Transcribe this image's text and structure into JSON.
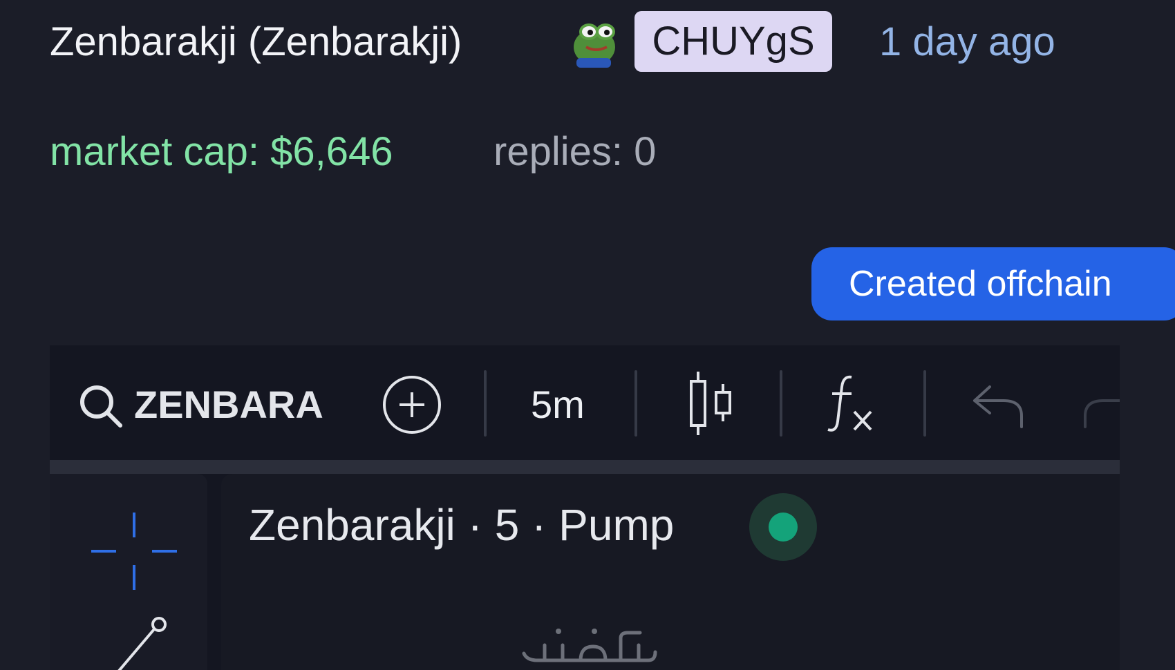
{
  "header": {
    "token_title": "Zenbarakji (Zenbarakji)",
    "ticker": "CHUYgS",
    "time_ago": "1 day ago",
    "avatar_icon": "frog-avatar-icon"
  },
  "stats": {
    "market_cap": "market cap: $6,646",
    "replies": "replies: 0"
  },
  "created_button": {
    "label": "Created offchain"
  },
  "chart_widget": {
    "toolbar": {
      "symbol": "ZENBARA",
      "interval": "5m",
      "icons": [
        "search-icon",
        "add-icon",
        "candlestick-icon",
        "fx-icon",
        "undo-icon",
        "redo-icon"
      ]
    },
    "left_toolbar": {
      "icons": [
        "crosshair-icon",
        "trendline-icon"
      ]
    },
    "legend": {
      "title": "Zenbarakji · 5 · Pump"
    }
  },
  "colors": {
    "background": "#1b1d28",
    "market_cap": "#82e3a6",
    "time_ago": "#93b4e6",
    "ticker_badge": "#ddd7f3",
    "button": "#2563e6",
    "status_dot": "#14a37a",
    "crosshair": "#2f6fe6"
  }
}
